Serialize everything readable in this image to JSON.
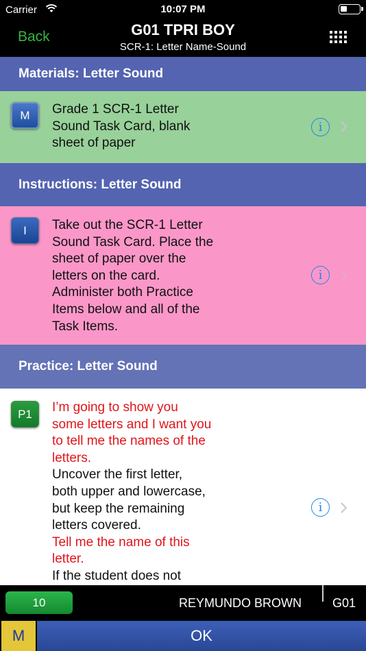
{
  "status_bar": {
    "carrier": "Carrier",
    "time": "10:07 PM"
  },
  "nav": {
    "back_label": "Back",
    "title": "G01 TPRI BOY",
    "subtitle": "SCR-1: Letter Name-Sound"
  },
  "sections": [
    {
      "header": "Materials: Letter Sound",
      "header_color": "#5464b0",
      "card_color": "#98d19a",
      "badge": "M",
      "lines": [
        {
          "text": "Grade 1 SCR-1 Letter",
          "red": false
        },
        {
          "text": "Sound Task Card, blank",
          "red": false
        },
        {
          "text": "sheet of paper",
          "red": false
        }
      ]
    },
    {
      "header": "Instructions: Letter Sound",
      "header_color": "#5464b0",
      "card_color": "#fb97c8",
      "badge": "I",
      "lines": [
        {
          "text": "Take out the SCR-1 Letter",
          "red": false
        },
        {
          "text": "Sound Task Card. Place the",
          "red": false
        },
        {
          "text": "sheet of paper over the",
          "red": false
        },
        {
          "text": "letters on the card.",
          "red": false
        },
        {
          "text": "Administer both Practice",
          "red": false
        },
        {
          "text": "Items below and all of the",
          "red": false
        },
        {
          "text": "Task Items.",
          "red": false
        }
      ]
    },
    {
      "header": "Practice: Letter Sound",
      "header_color": "#6473b6",
      "card_color": "#ffffff",
      "badge": "P1",
      "lines": [
        {
          "text": "I’m going to show you",
          "red": true
        },
        {
          "text": "some letters and I want you",
          "red": true
        },
        {
          "text": "to tell me the names of the",
          "red": true
        },
        {
          "text": "letters.",
          "red": true
        },
        {
          "text": "Uncover the first letter,",
          "red": false
        },
        {
          "text": "both upper and lowercase,",
          "red": false
        },
        {
          "text": "but keep the remaining",
          "red": false
        },
        {
          "text": "letters covered.",
          "red": false
        },
        {
          "text": "Tell me the name of this",
          "red": true
        },
        {
          "text": "letter.",
          "red": true
        },
        {
          "text": "If the student does not",
          "red": false
        }
      ]
    }
  ],
  "icons": {
    "info": "info-icon",
    "chevron": "chevron-right-icon",
    "grid": "grid-icon",
    "wifi": "wifi-icon",
    "battery": "battery-icon"
  },
  "bottom": {
    "score": "10",
    "student_name": "REYMUNDO BROWN",
    "grade": "G01",
    "m_button": "M",
    "ok_button": "OK"
  },
  "colors": {
    "back_green": "#35b53f",
    "info_blue": "#1f86ee",
    "red_text": "#e0151b",
    "m_yellow": "#e3c63a",
    "ok_blue": "#3150a4"
  }
}
